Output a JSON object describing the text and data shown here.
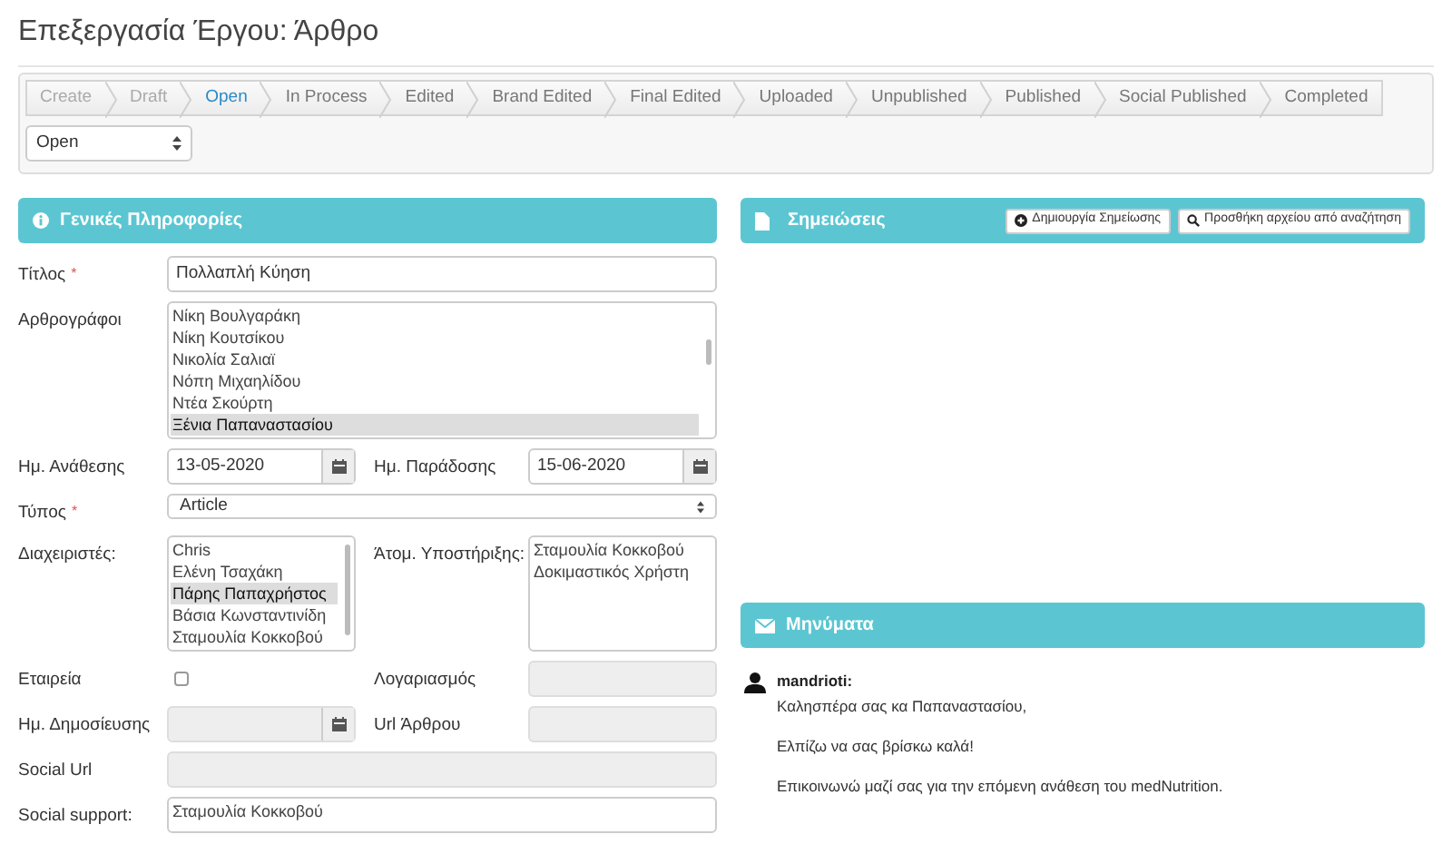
{
  "page_title": "Επεξεργασία Έργου: Άρθρο",
  "workflow": {
    "steps": [
      {
        "label": "Create",
        "selected": false,
        "disabled": true
      },
      {
        "label": "Draft",
        "selected": false,
        "disabled": true
      },
      {
        "label": "Open",
        "selected": true,
        "disabled": false
      },
      {
        "label": "In Process",
        "selected": false,
        "disabled": false
      },
      {
        "label": "Edited",
        "selected": false,
        "disabled": false
      },
      {
        "label": "Brand Edited",
        "selected": false,
        "disabled": false
      },
      {
        "label": "Final Edited",
        "selected": false,
        "disabled": false
      },
      {
        "label": "Uploaded",
        "selected": false,
        "disabled": false
      },
      {
        "label": "Unpublished",
        "selected": false,
        "disabled": false
      },
      {
        "label": "Published",
        "selected": false,
        "disabled": false
      },
      {
        "label": "Social Published",
        "selected": false,
        "disabled": false
      },
      {
        "label": "Completed",
        "selected": false,
        "disabled": false
      }
    ],
    "status_select": {
      "value": "Open"
    }
  },
  "general_info": {
    "title": "Γενικές Πληροφορίες",
    "rows": [
      {
        "fields": [
          {
            "label": "Τίτλος",
            "required_mark": "*",
            "kind": "text",
            "value": "Πολλαπλή Κύηση",
            "disabled": false
          }
        ]
      },
      {
        "fields": [
          {
            "label": "Αρθρογράφοι",
            "kind": "listbox",
            "options": [
              {
                "label": "Νίκη Βουλγαράκη",
                "selected": false
              },
              {
                "label": "Νίκη Κουτσίκου",
                "selected": false
              },
              {
                "label": "Νικολία Σαλιαϊ",
                "selected": false
              },
              {
                "label": "Νόπη Μιχαηλίδου",
                "selected": false
              },
              {
                "label": "Ντέα Σκούρτη",
                "selected": false
              },
              {
                "label": "Ξένια Παπαναστασίου",
                "selected": true
              }
            ]
          }
        ]
      },
      {
        "fields": [
          {
            "label": "Ημ. Ανάθεσης",
            "kind": "date",
            "value": "13-05-2020",
            "disabled": false
          },
          {
            "label": "Ημ. Παράδοσης",
            "kind": "date",
            "value": "15-06-2020",
            "disabled": false
          }
        ]
      },
      {
        "fields": [
          {
            "label": "Τύπος",
            "required_mark": "*",
            "kind": "select",
            "value": "Article"
          }
        ]
      },
      {
        "fields": [
          {
            "label": "Διαχειριστές:",
            "kind": "listbox",
            "options": [
              {
                "label": "Chris",
                "selected": false
              },
              {
                "label": "Ελένη Τσαχάκη",
                "selected": false
              },
              {
                "label": "Πάρης Παπαχρήστος",
                "selected": true
              },
              {
                "label": "Βάσια Κωνσταντινίδη",
                "selected": false
              },
              {
                "label": "Σταμουλία Κοκκοβού",
                "selected": false
              }
            ]
          },
          {
            "label": "Άτομ. Υποστήριξης:",
            "kind": "listbox",
            "options": [
              {
                "label": "Σταμουλία Κοκκοβού",
                "selected": false
              },
              {
                "label": "Δοκιμαστικός Χρήστη",
                "selected": false
              }
            ]
          }
        ]
      },
      {
        "fields": [
          {
            "label": "Εταιρεία",
            "kind": "checkbox",
            "checked": false
          },
          {
            "label": "Λογαριασμός",
            "kind": "text",
            "disabled": true
          }
        ]
      },
      {
        "fields": [
          {
            "label": "Ημ. Δημοσίευσης",
            "kind": "date",
            "disabled": true
          },
          {
            "label": "Url Άρθρου",
            "kind": "text",
            "disabled": true
          }
        ]
      },
      {
        "fields": [
          {
            "label": "Social Url",
            "kind": "text",
            "disabled": true
          }
        ]
      },
      {
        "fields": [
          {
            "label": "Social support:",
            "kind": "listbox",
            "options": [
              {
                "label": "Σταμουλία Κοκκοβού",
                "selected": false
              }
            ]
          }
        ]
      }
    ]
  },
  "notes": {
    "title": "Σημειώσεις",
    "buttons": [
      {
        "kind": "create",
        "label": "Δημιουργία Σημείωσης"
      },
      {
        "kind": "search",
        "label": "Προσθήκη αρχείου από αναζήτηση"
      }
    ]
  },
  "messages": {
    "title": "Μηνύματα",
    "items": [
      {
        "author": "mandrioti:",
        "paragraphs": [
          "Καλησπέρα σας κα Παπαναστασίου,",
          "Ελπίζω να σας βρίσκω καλά!",
          "Επικοινωνώ μαζί σας για την επόμενη ανάθεση του medNutrition."
        ]
      }
    ]
  }
}
